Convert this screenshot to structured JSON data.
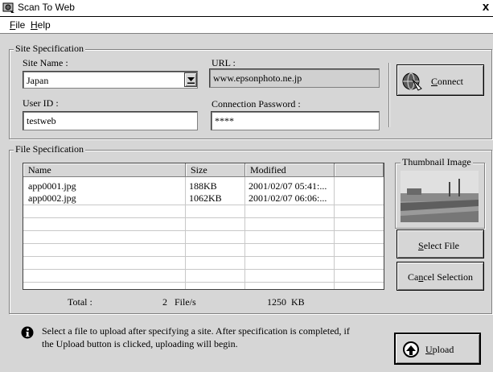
{
  "window": {
    "title": "Scan To Web",
    "close_glyph": "x"
  },
  "menu": {
    "items": [
      {
        "label": "File",
        "accel": "F",
        "rest": "ile"
      },
      {
        "label": "Help",
        "accel": "H",
        "rest": "elp"
      }
    ]
  },
  "site": {
    "legend": "Site Specification",
    "site_name_label": "Site Name :",
    "site_name_value": "Japan",
    "url_label": "URL :",
    "url_value": "www.epsonphoto.ne.jp",
    "user_id_label": "User ID :",
    "user_id_value": "testweb",
    "password_label": "Connection Password :",
    "password_value": "****",
    "connect_label_accel": "C",
    "connect_label_rest": "onnect"
  },
  "files": {
    "legend": "File Specification",
    "columns": [
      "Name",
      "Size",
      "Modified"
    ],
    "rows": [
      {
        "name": "app0001.jpg",
        "size": "188KB",
        "modified": "2001/02/07 05:41:..."
      },
      {
        "name": "app0002.jpg",
        "size": "1062KB",
        "modified": "2001/02/07 06:06:..."
      }
    ],
    "total_label": "Total :",
    "total_count": "2",
    "total_unit": "File/s",
    "total_size": "1250",
    "total_size_unit": "KB",
    "thumbnail_legend": "Thumbnail Image",
    "select_file_accel": "S",
    "select_file_rest": "elect File",
    "cancel_pre": "Ca",
    "cancel_accel": "n",
    "cancel_rest": "cel Selection"
  },
  "footer": {
    "info_line1": "Select a file to upload after specifying a site. After specification is completed, if",
    "info_line2": "the Upload button is clicked, uploading will begin.",
    "upload_accel": "U",
    "upload_rest": "pload"
  },
  "icons": [
    "app-icon",
    "dropdown-arrow-icon",
    "connect-icon",
    "info-icon",
    "upload-icon"
  ]
}
